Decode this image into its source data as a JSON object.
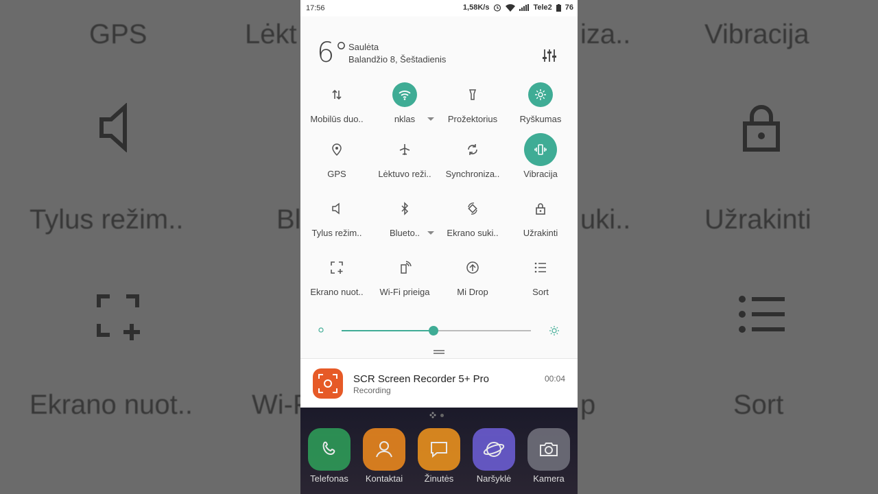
{
  "status": {
    "time": "17:56",
    "speed": "1,58K/s",
    "carrier": "Tele2",
    "battery": "76"
  },
  "weather": {
    "temp": "6°",
    "condition": "Saulėta",
    "date": "Balandžio 8, Šeštadienis"
  },
  "tiles": [
    {
      "label": "Mobilūs duo..",
      "icon": "mobile-data-icon",
      "on": false
    },
    {
      "label": "nklas",
      "icon": "wifi-icon",
      "on": true
    },
    {
      "label": "Prožektorius",
      "icon": "flashlight-icon",
      "on": false
    },
    {
      "label": "Ryškumas",
      "icon": "brightness-icon",
      "on": true
    },
    {
      "label": "GPS",
      "icon": "location-icon",
      "on": false
    },
    {
      "label": "Lėktuvo reži..",
      "icon": "airplane-icon",
      "on": false
    },
    {
      "label": "Synchroniza..",
      "icon": "sync-icon",
      "on": false
    },
    {
      "label": "Vibracija",
      "icon": "vibration-icon",
      "on": true
    },
    {
      "label": "Tylus režim..",
      "icon": "speaker-icon",
      "on": false
    },
    {
      "label": "Blueto..",
      "icon": "bluetooth-icon",
      "on": false
    },
    {
      "label": "Ekrano suki..",
      "icon": "rotate-icon",
      "on": false
    },
    {
      "label": "Užrakinti",
      "icon": "lock-icon",
      "on": false
    },
    {
      "label": "Ekrano nuot..",
      "icon": "screenshot-icon",
      "on": false
    },
    {
      "label": "Wi-Fi prieiga",
      "icon": "hotspot-icon",
      "on": false
    },
    {
      "label": "Mi Drop",
      "icon": "midrop-icon",
      "on": false
    },
    {
      "label": "Sort",
      "icon": "sort-icon",
      "on": false
    }
  ],
  "brightness": {
    "level": 0.5
  },
  "notification": {
    "title": "SCR Screen Recorder 5+ Pro",
    "subtitle": "Recording",
    "time": "00:04"
  },
  "dock": [
    {
      "label": "Telefonas",
      "icon": "phone-icon",
      "color": "#2e9a58"
    },
    {
      "label": "Kontaktai",
      "icon": "contacts-icon",
      "color": "#e8861e"
    },
    {
      "label": "Žinutės",
      "icon": "messages-icon",
      "color": "#e8901e"
    },
    {
      "label": "Naršyklė",
      "icon": "browser-icon",
      "color": "#6a5cd0"
    },
    {
      "label": "Kamera",
      "icon": "camera-icon",
      "color": "#6f6f7a"
    }
  ],
  "background_labels": [
    "GPS",
    "Lėkt",
    "iza..",
    "Vibracija",
    "Tylus režim..",
    "Bl",
    "uki..",
    "Užrakinti",
    "Ekrano nuot..",
    "Wi-F",
    "p",
    "Sort"
  ]
}
